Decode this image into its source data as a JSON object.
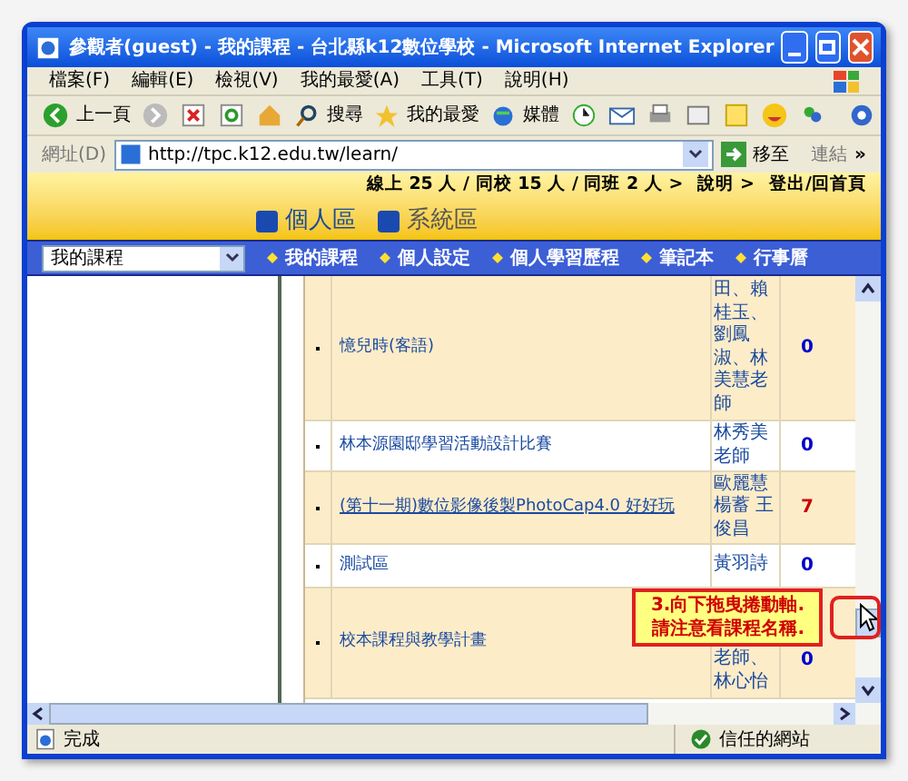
{
  "window": {
    "title": "參觀者(guest) - 我的課程 - 台北縣k12數位學校 - Microsoft Internet Explorer"
  },
  "menu": [
    "檔案(F)",
    "編輯(E)",
    "檢視(V)",
    "我的最愛(A)",
    "工具(T)",
    "說明(H)"
  ],
  "toolbar": {
    "back": "上一頁",
    "search": "搜尋",
    "favorites": "我的最愛",
    "media": "媒體"
  },
  "address_bar": {
    "label": "網址(D)",
    "value": "http://tpc.k12.edu.tw/learn/",
    "go": "移至",
    "links": "連結",
    "more": "»"
  },
  "header": {
    "online": "線上 25 人 / 同校 15 人 / 同班 2 人 >",
    "help": "說明 >",
    "logout": "登出/回首頁",
    "areas": [
      {
        "label": "個人區",
        "kind": "personal"
      },
      {
        "label": "系統區",
        "kind": "system"
      }
    ]
  },
  "nav": {
    "dropdown": "我的課程",
    "links": [
      "我的課程",
      "個人設定",
      "個人學習歷程",
      "筆記本",
      "行事曆"
    ]
  },
  "courses": [
    {
      "name": "憶兒時(客語)",
      "teacher": "田、賴桂玉、劉鳳淑、林美慧老師",
      "count": "0",
      "color": "#0000cc",
      "hovered": false
    },
    {
      "name": "林本源園邸學習活動設計比賽",
      "teacher": "林秀美老師",
      "count": "0",
      "color": "#0000cc",
      "hovered": false
    },
    {
      "name": "(第十一期)數位影像後製PhotoCap4.0 好好玩",
      "teacher": "歐麗慧楊蓄 王俊昌",
      "count": "7",
      "color": "#cc0000",
      "hovered": true
    },
    {
      "name": "測試區",
      "teacher": "黃羽詩",
      "count": "0",
      "color": "#0000cc",
      "hovered": false
    },
    {
      "name": "校本課程與教學計畫",
      "teacher": "老師、林心怡",
      "count": "0",
      "color": "#0000cc",
      "hovered": false
    }
  ],
  "callout": [
    "3.向下拖曳捲動軸.",
    "請注意看課程名稱."
  ],
  "status_bar": {
    "text": "完成",
    "zone": "信任的網站"
  }
}
